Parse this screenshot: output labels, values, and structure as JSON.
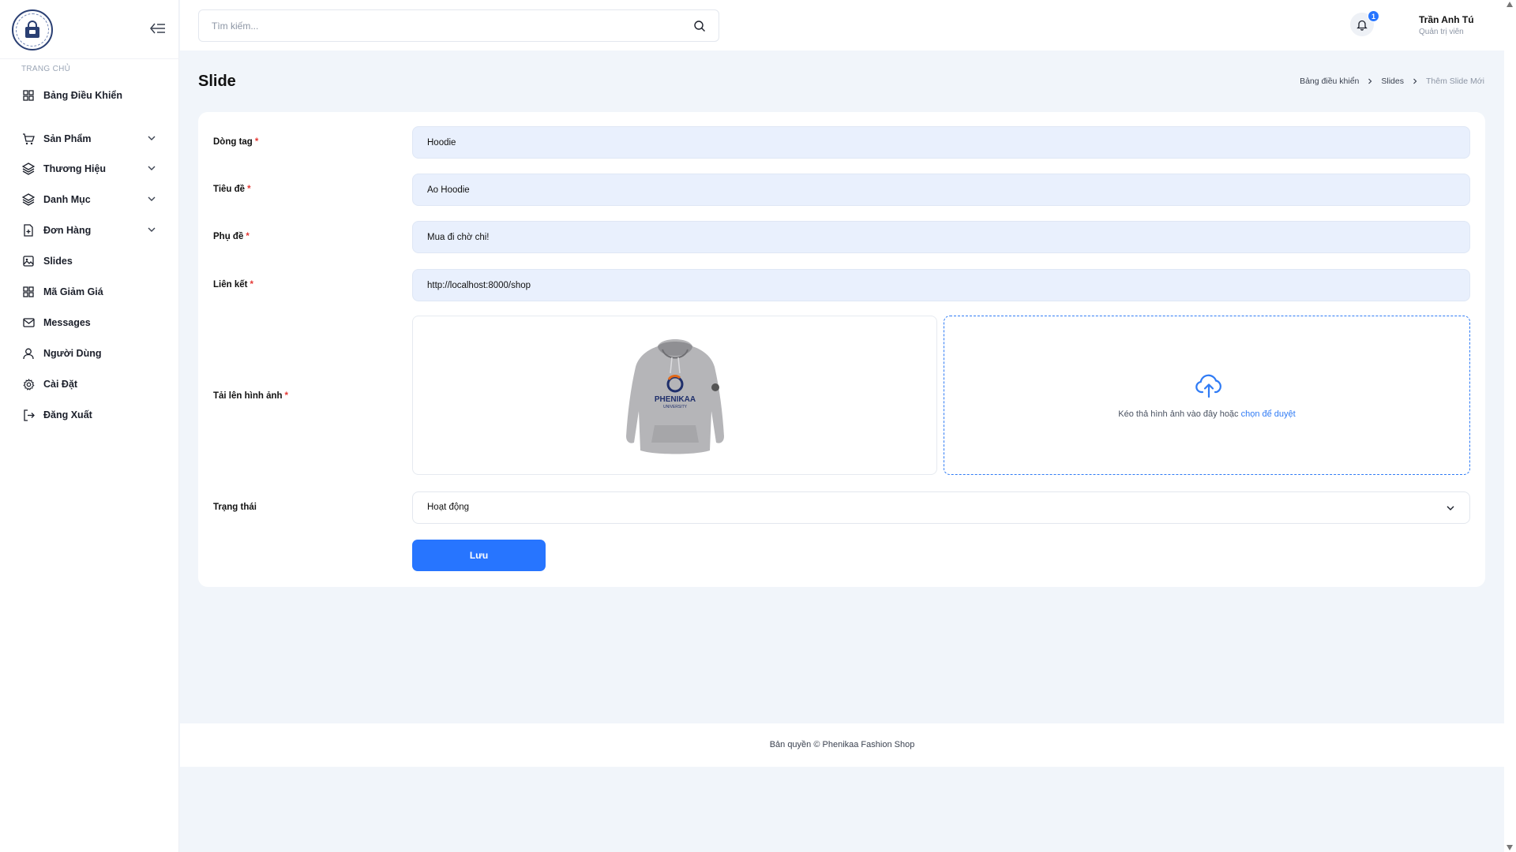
{
  "sidebar": {
    "section_label": "TRANG CHỦ",
    "items": [
      {
        "label": "Bảng Điều Khiển",
        "icon": "grid-icon"
      },
      {
        "label": "Sản Phẩm",
        "icon": "cart-icon"
      },
      {
        "label": "Thương Hiệu",
        "icon": "layers-icon"
      },
      {
        "label": "Danh Mục",
        "icon": "layers-icon"
      },
      {
        "label": "Đơn Hàng",
        "icon": "file-icon"
      },
      {
        "label": "Slides",
        "icon": "image-icon"
      },
      {
        "label": "Mã Giảm Giá",
        "icon": "grid-icon"
      },
      {
        "label": "Messages",
        "icon": "mail-icon"
      },
      {
        "label": "Người Dùng",
        "icon": "user-icon"
      },
      {
        "label": "Cài Đặt",
        "icon": "gear-icon"
      },
      {
        "label": "Đăng Xuất",
        "icon": "logout-icon"
      }
    ]
  },
  "header": {
    "search_placeholder": "Tìm kiếm...",
    "notification_count": "1",
    "user_name": "Trần Anh Tú",
    "user_role": "Quản trị viên"
  },
  "page": {
    "title": "Slide",
    "breadcrumb": [
      "Bảng điều khiển",
      "Slides",
      "Thêm Slide Mới"
    ]
  },
  "form": {
    "tag_label": "Dòng tag",
    "tag_value": "Hoodie",
    "title_label": "Tiêu đề",
    "title_value": "Áo Hoodie",
    "subtitle_label": "Phụ đề",
    "subtitle_value": "Mua đi chờ chi!",
    "link_label": "Liên kết",
    "link_value": "http://localhost:8000/shop",
    "upload_label": "Tải lên hình ảnh",
    "upload_hint": "Kéo thả hình ảnh vào đây hoặc ",
    "upload_link": "chọn để duyệt",
    "status_label": "Trạng thái",
    "status_value": "Hoạt động",
    "save_label": "Lưu",
    "required_mark": "*"
  },
  "preview_image": {
    "logo_text": "PHENIKAA",
    "logo_subtext": "UNIVERSITY"
  },
  "footer": {
    "text": "Bản quyền © Phenikaa Fashion Shop"
  },
  "colors": {
    "accent": "#2775ff",
    "input_bg": "#e9f0fd",
    "page_bg": "#f1f5fa"
  }
}
